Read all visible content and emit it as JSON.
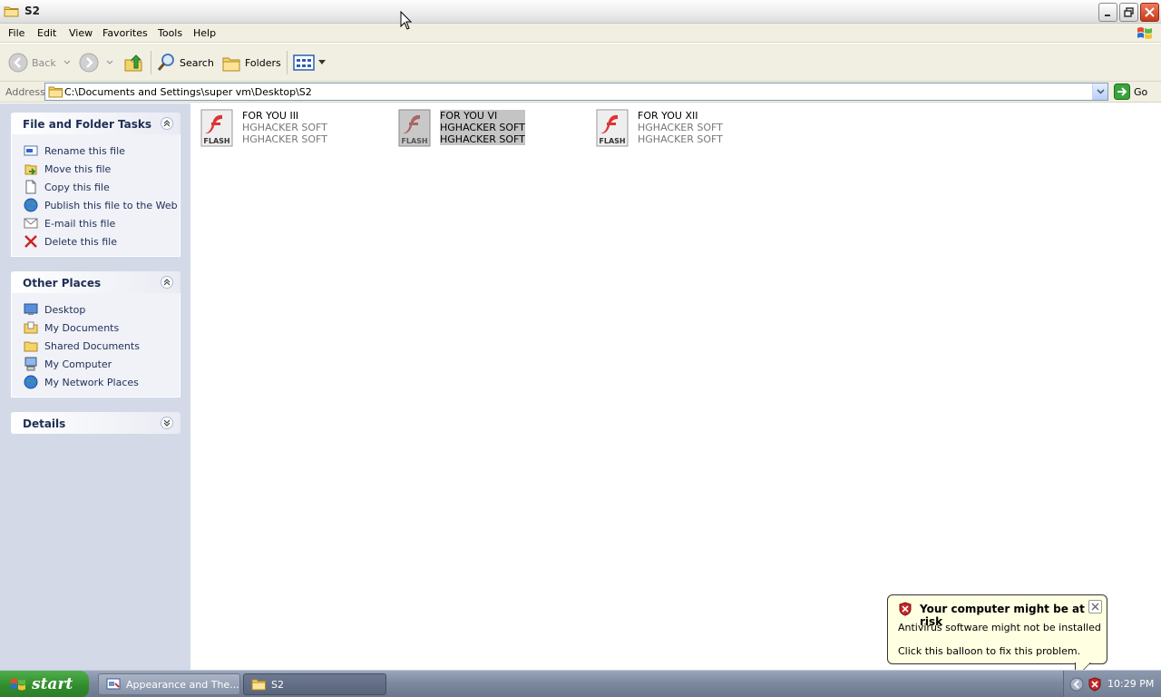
{
  "window": {
    "title": "S2",
    "buttons": {
      "minimize": "_",
      "maximize": "❐",
      "close": "✕"
    }
  },
  "menu": [
    "File",
    "Edit",
    "View",
    "Favorites",
    "Tools",
    "Help"
  ],
  "toolbar": {
    "back": "Back",
    "search": "Search",
    "folders": "Folders"
  },
  "address": {
    "label": "Address",
    "path": "C:\\Documents and Settings\\super vm\\Desktop\\S2",
    "go": "Go"
  },
  "left_pane": {
    "file_tasks": {
      "title": "File and Folder Tasks",
      "items": [
        "Rename this file",
        "Move this file",
        "Copy this file",
        "Publish this file to the Web",
        "E-mail this file",
        "Delete this file"
      ]
    },
    "other_places": {
      "title": "Other Places",
      "items": [
        "Desktop",
        "My Documents",
        "Shared Documents",
        "My Computer",
        "My Network Places"
      ]
    },
    "details": {
      "title": "Details"
    }
  },
  "files": [
    {
      "name": "FOR YOU III",
      "line2": "HGHACKER SOFT",
      "line3": "HGHACKER SOFT",
      "icon_label": "FLASH",
      "selected": false
    },
    {
      "name": "FOR YOU VI",
      "line2": "HGHACKER SOFT",
      "line3": "HGHACKER SOFT",
      "icon_label": "FLASH",
      "selected": true
    },
    {
      "name": "FOR YOU XII",
      "line2": "HGHACKER SOFT",
      "line3": "HGHACKER SOFT",
      "icon_label": "FLASH",
      "selected": false
    }
  ],
  "balloon": {
    "title": "Your computer might be at risk",
    "line1": "Antivirus software might not be installed",
    "line2": "Click this balloon to fix this problem."
  },
  "taskbar": {
    "start": "start",
    "items": [
      {
        "label": "Appearance and The...",
        "active": false
      },
      {
        "label": "S2",
        "active": true
      }
    ],
    "clock": "10:29 PM"
  }
}
